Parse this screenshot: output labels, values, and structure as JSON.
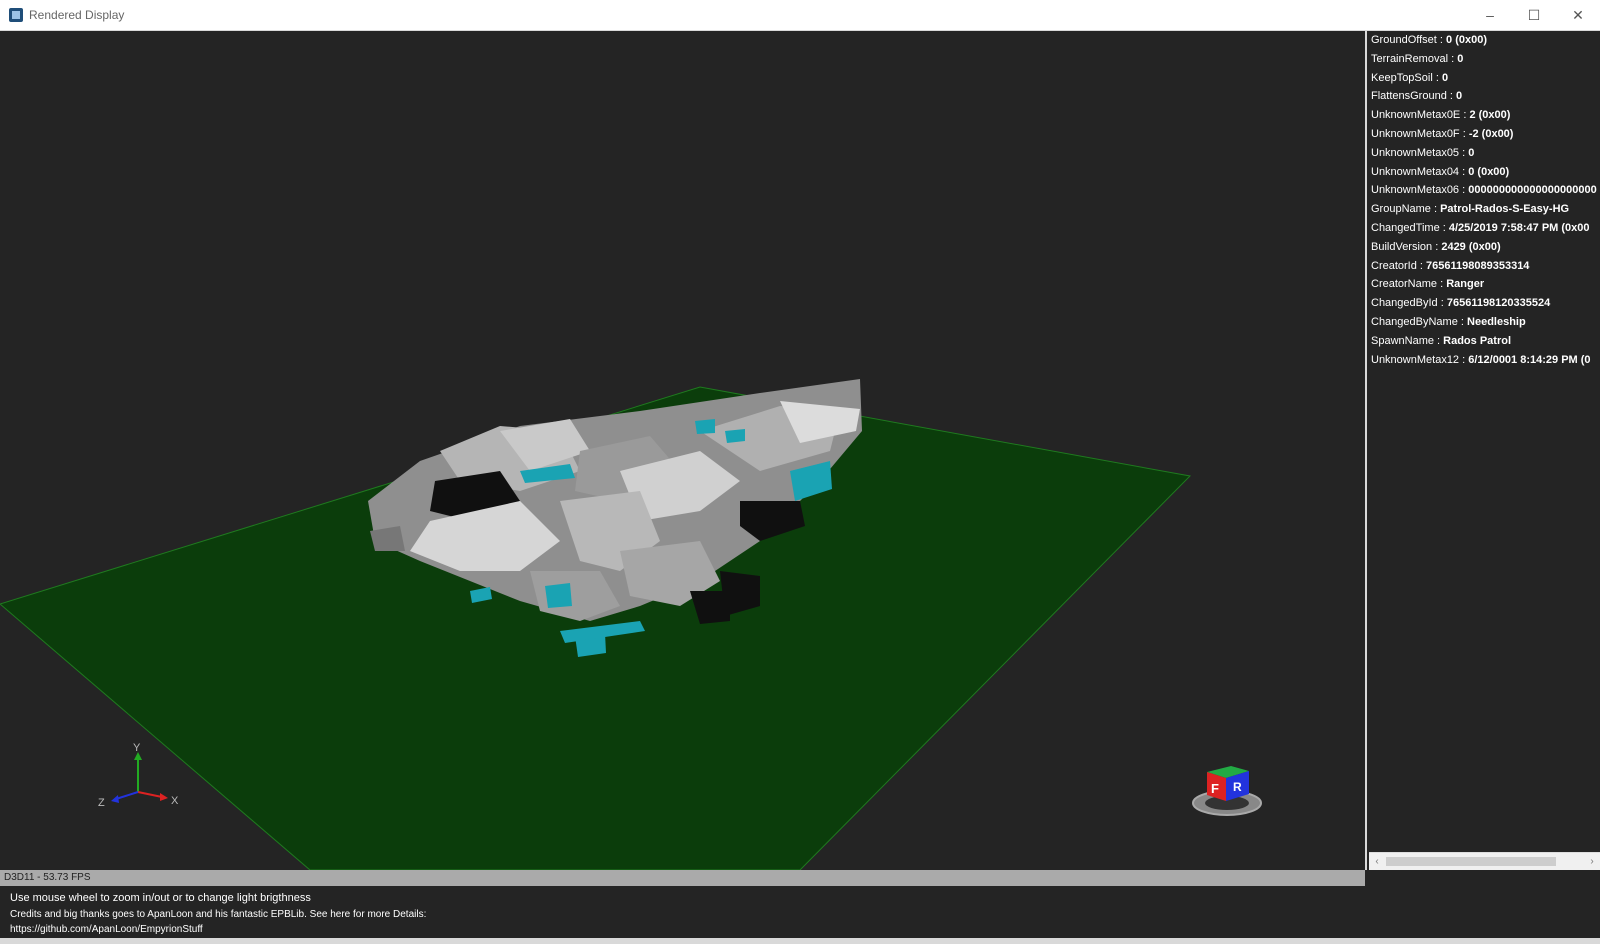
{
  "window": {
    "title": "Rendered Display",
    "minimize_glyph": "–",
    "maximize_glyph": "☐",
    "close_glyph": "✕",
    "icon": "app-icon"
  },
  "viewport": {
    "background": "#242424",
    "ground_color": "#0b3d0b",
    "accent_color": "#1aa3b3",
    "axes": {
      "x_label": "X",
      "y_label": "Y",
      "z_label": "Z"
    },
    "view_cube": {
      "front_label": "F",
      "right_label": "R"
    }
  },
  "properties": [
    {
      "key": "GroundOffset",
      "value": "0 (0x00)"
    },
    {
      "key": "TerrainRemoval",
      "value": "0"
    },
    {
      "key": "KeepTopSoil",
      "value": "0"
    },
    {
      "key": "FlattensGround",
      "value": "0"
    },
    {
      "key": "UnknownMetax0E",
      "value": "2 (0x00)"
    },
    {
      "key": "UnknownMetax0F",
      "value": "-2 (0x00)"
    },
    {
      "key": "UnknownMetax05",
      "value": "0"
    },
    {
      "key": "UnknownMetax04",
      "value": "0 (0x00)"
    },
    {
      "key": "UnknownMetax06",
      "value": "000000000000000000000"
    },
    {
      "key": "GroupName",
      "value": "Patrol-Rados-S-Easy-HG"
    },
    {
      "key": "ChangedTime",
      "value": "4/25/2019 7:58:47 PM (0x00"
    },
    {
      "key": "BuildVersion",
      "value": "2429 (0x00)"
    },
    {
      "key": "CreatorId",
      "value": "76561198089353314"
    },
    {
      "key": "CreatorName",
      "value": "Ranger"
    },
    {
      "key": "ChangedById",
      "value": "76561198120335524"
    },
    {
      "key": "ChangedByName",
      "value": "Needleship"
    },
    {
      "key": "SpawnName",
      "value": "Rados Patrol"
    },
    {
      "key": "UnknownMetax12",
      "value": "6/12/0001 8:14:29 PM (0"
    }
  ],
  "status": {
    "fps": "D3D11 - 53.73 FPS"
  },
  "help": {
    "line1": "Use mouse wheel to zoom in/out or to change light brigthness",
    "line2": "Credits and big thanks goes to ApanLoon and his fantastic EPBLib. See here for more Details:",
    "line3": "https://github.com/ApanLoon/EmpyrionStuff"
  },
  "scrollbar": {
    "left_arrow": "‹",
    "right_arrow": "›"
  }
}
